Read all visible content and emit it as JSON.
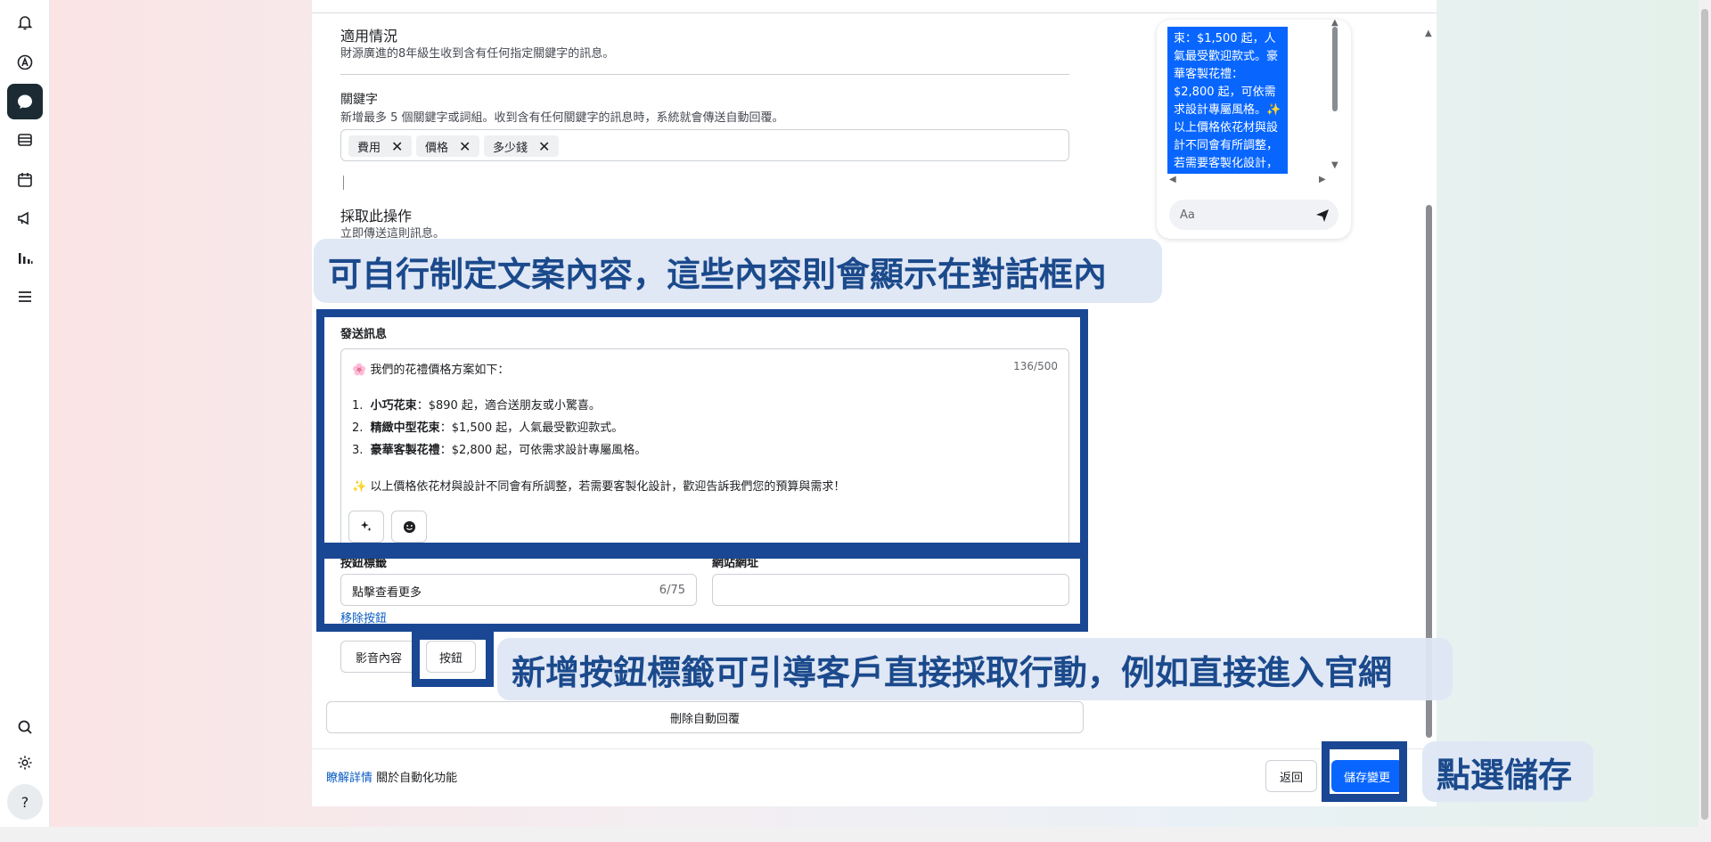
{
  "applicability": {
    "title": "適用情況",
    "desc": "財源廣進的8年級生收到含有任何指定關鍵字的訊息。"
  },
  "keywords": {
    "title": "關鍵字",
    "desc": "新增最多 5 個關鍵字或詞組。收到含有任何關鍵字的訊息時，系統就會傳送自動回覆。",
    "chips": [
      "費用",
      "價格",
      "多少錢"
    ]
  },
  "action": {
    "title": "採取此操作",
    "desc": "立即傳送這則訊息。"
  },
  "message": {
    "label": "發送訊息",
    "counter": "136/500",
    "intro": "我們的花禮價格方案如下：",
    "items": [
      {
        "num": "1.",
        "bold": "小巧花束",
        "text": "：$890 起，適合送朋友或小驚喜。"
      },
      {
        "num": "2.",
        "bold": "精緻中型花束",
        "text": "：$1,500 起，人氣最受歡迎款式。"
      },
      {
        "num": "3.",
        "bold": "豪華客製花禮",
        "text": "：$2,800 起，可依需求設計專屬風格。"
      }
    ],
    "note": "以上價格依花材與設計不同會有所調整，若需要客製化設計，歡迎告訴我們您的預算與需求！"
  },
  "button_label": {
    "label": "按鈕標籤",
    "value": "點擊查看更多",
    "counter": "6/75"
  },
  "website": {
    "label": "網站網址",
    "value": ""
  },
  "remove_button_link": "移除按鈕",
  "media_button": "影音內容",
  "button_button": "按鈕",
  "delete_auto_reply": "刪除自動回覆",
  "footer": {
    "learn_more": "瞭解詳情",
    "about": "關於自動化功能",
    "back": "返回",
    "save": "儲存變更"
  },
  "preview": {
    "bubble_text": "束：$1,500 起，人氣最受歡迎款式。豪華客製花禮：$2,800 起，可依需求設計專屬風格。✨ 以上價格依花材與設計不同會有所調整，若需要客製化設計，歡迎告訴",
    "compose_placeholder": "Aa"
  },
  "annotations": {
    "callout_1": "可自行制定文案內容，這些內容則會顯示在對話框內",
    "callout_2": "新增按鈕標籤可引導客戶直接採取行動，例如直接進入官網",
    "callout_3": "點選儲存"
  },
  "colors": {
    "accent": "#0866ff",
    "annotation_frame": "#1a4793",
    "annotation_text": "#1b4a8c"
  }
}
